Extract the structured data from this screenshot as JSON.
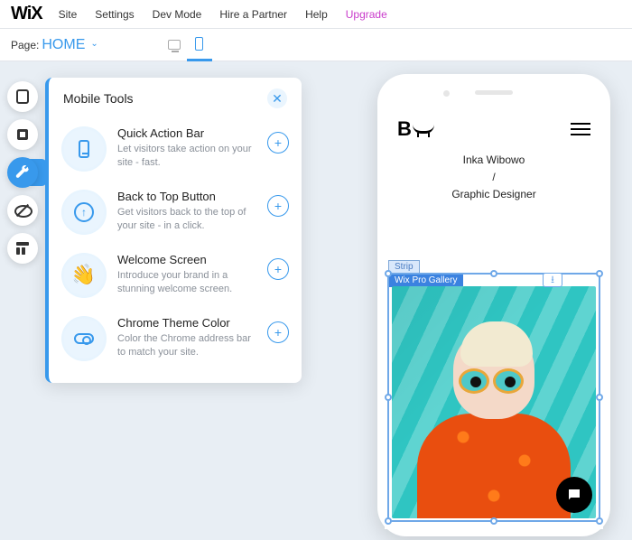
{
  "logo": "WiX",
  "menu": [
    "Site",
    "Settings",
    "Dev Mode",
    "Hire a Partner",
    "Help",
    "Upgrade"
  ],
  "page_label": "Page:",
  "page_name": "HOME",
  "panel": {
    "title": "Mobile Tools",
    "tools": [
      {
        "title": "Quick Action Bar",
        "desc": "Let visitors take action on your site - fast."
      },
      {
        "title": "Back to Top Button",
        "desc": "Get visitors back to the top of your site - in a click."
      },
      {
        "title": "Welcome Screen",
        "desc": "Introduce your brand in a stunning welcome screen."
      },
      {
        "title": "Chrome Theme Color",
        "desc": "Color the Chrome address bar to match your site."
      }
    ]
  },
  "preview": {
    "logo_letter": "B",
    "name": "Inka Wibowo",
    "sep": "/",
    "role": "Graphic Designer",
    "strip_label": "Strip",
    "gallery_label": "Wix Pro Gallery"
  }
}
